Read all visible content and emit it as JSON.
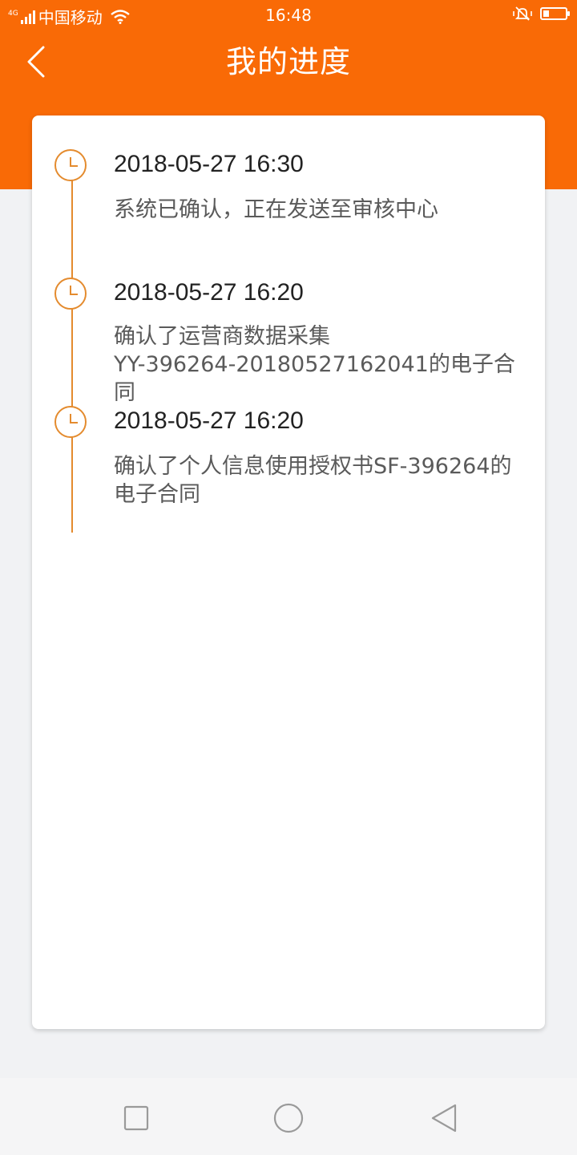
{
  "status_bar": {
    "network": "4G",
    "carrier": "中国移动",
    "time": "16:48",
    "battery_level": 0.25
  },
  "header": {
    "title": "我的进度",
    "back_icon": "chevron-left-icon"
  },
  "timeline": {
    "items": [
      {
        "time": "2018-05-27 16:30",
        "description_lines": [
          "系统已确认，正在发送至审核中心"
        ]
      },
      {
        "time": "2018-05-27 16:20",
        "description_lines": [
          "确认了运营商数据采集",
          "YY-396264-20180527162041的电子合同"
        ]
      },
      {
        "time": "2018-05-27 16:20",
        "description_lines": [
          "确认了个人信息使用授权书SF-396264的",
          "电子合同"
        ]
      }
    ]
  },
  "nav_bar": {
    "icons": [
      "recent-apps-icon",
      "home-icon",
      "back-icon"
    ]
  },
  "colors": {
    "brand_orange": "#f96a06",
    "timeline_orange": "#e48b2e"
  }
}
